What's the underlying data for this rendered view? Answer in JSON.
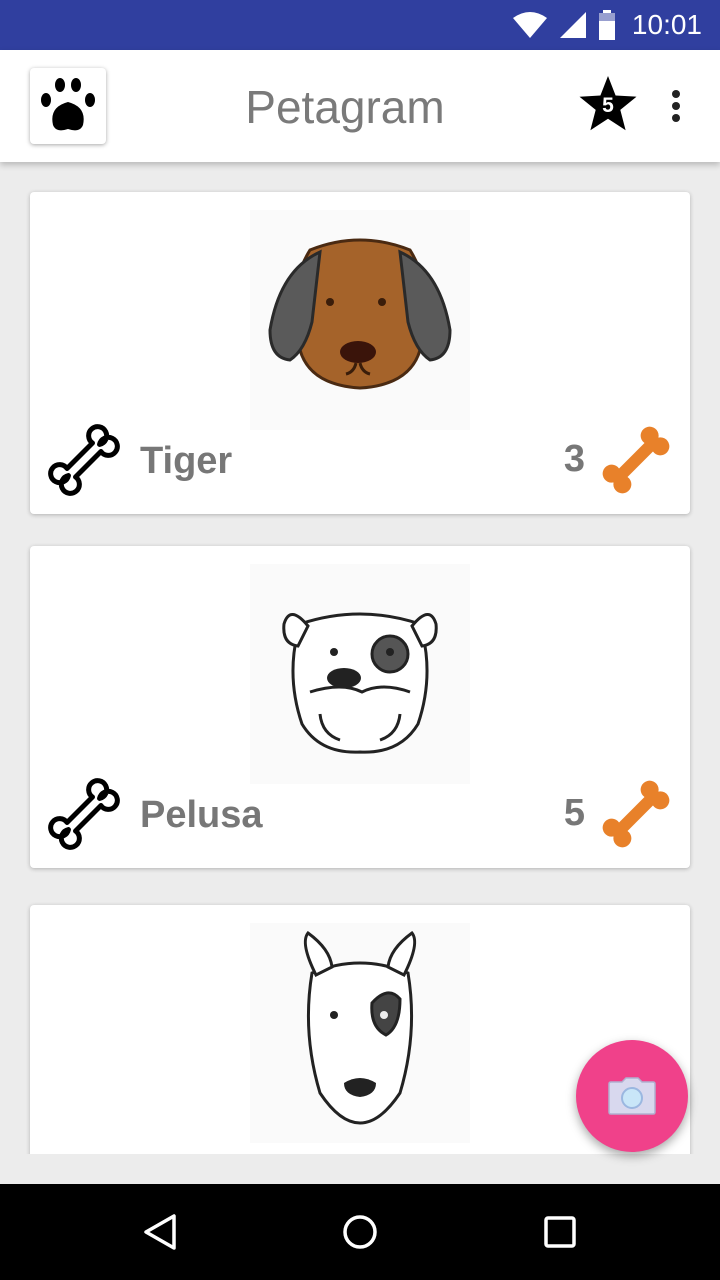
{
  "status_bar": {
    "time": "10:01",
    "icons": [
      "wifi-icon",
      "signal-icon",
      "battery-icon"
    ]
  },
  "app_bar": {
    "title": "Petagram",
    "logo_icon": "paw-icon",
    "favorites_icon": "star-icon",
    "favorites_count": "5",
    "menu_icon": "overflow-menu-icon"
  },
  "pets": [
    {
      "name": "Tiger",
      "rating": "3",
      "photo": "brown-dog-face"
    },
    {
      "name": "Pelusa",
      "rating": "5",
      "photo": "bulldog-face"
    },
    {
      "name": "",
      "rating": "",
      "photo": "bull-terrier-face"
    }
  ],
  "fab": {
    "icon": "camera-icon"
  },
  "nav_bar": {
    "icons": [
      "back-icon",
      "home-icon",
      "recents-icon"
    ]
  },
  "colors": {
    "status_bar": "#303f9f",
    "accent": "#f0418a",
    "bone_orange": "#e8812a",
    "text_gray": "#777777"
  }
}
